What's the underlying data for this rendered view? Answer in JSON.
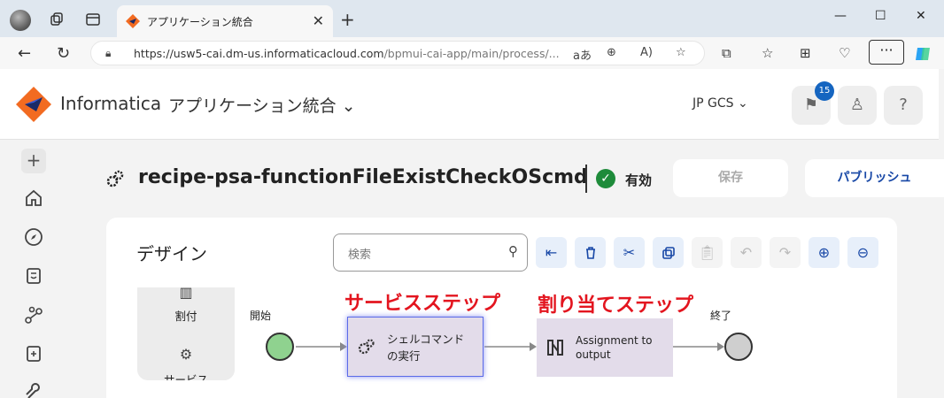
{
  "browser": {
    "tab_title": "アプリケーション統合",
    "tab_close": "✕",
    "new_tab": "+",
    "url_host": "https://usw5-cai.dm-us.informaticacloud.com",
    "url_rest": "/bpmui-cai-app/main/process/...",
    "url_tools": [
      "aあ",
      "⊕",
      "A)",
      "☆"
    ],
    "win_controls": [
      "—",
      "☐",
      "✕"
    ]
  },
  "header": {
    "brand": "Informatica",
    "app_name": "アプリケーション統合",
    "org": "JP GCS",
    "notifications_count": "15",
    "help": "?"
  },
  "process": {
    "name": "recipe-psa-functionFileExistCheckOScmd",
    "status": "有効",
    "save_label": "保存",
    "publish_label": "パブリッシュ"
  },
  "design": {
    "title": "デザイン",
    "search_placeholder": "検索",
    "palette": [
      {
        "label": "割付"
      },
      {
        "label": "サービス"
      }
    ],
    "start_label": "開始",
    "end_label": "終了",
    "service_step": {
      "line1": "シェルコマンド",
      "line2": "の実行"
    },
    "assign_step": {
      "line1": "Assignment to",
      "line2": "output"
    },
    "annotation_service": "サービスステップ",
    "annotation_assign": "割り当てステップ"
  },
  "colors": {
    "accent": "#1747a6",
    "annotation": "#e3151f",
    "start_node": "#8fd28f",
    "step_fill": "#e3dcea"
  }
}
